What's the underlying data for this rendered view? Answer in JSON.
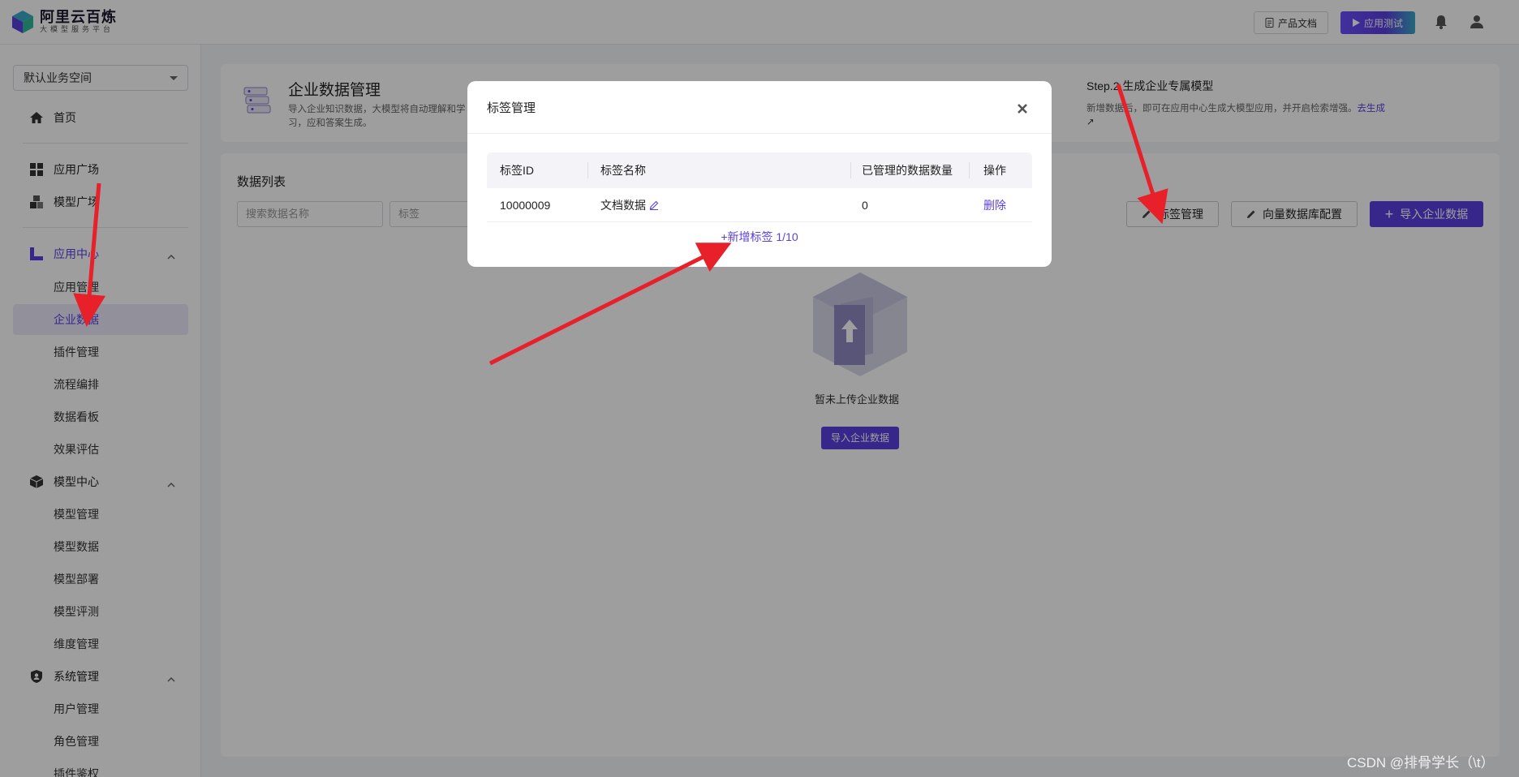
{
  "header": {
    "logo_title": "阿里云百炼",
    "logo_subtitle": "大模型服务平台",
    "doc_button": "产品文档",
    "test_button": "应用测试"
  },
  "sidebar": {
    "workspace": "默认业务空间",
    "items": {
      "home": "首页",
      "app_square": "应用广场",
      "model_square": "模型广场",
      "app_center": "应用中心",
      "app_manage": "应用管理",
      "enterprise_data": "企业数据",
      "plugin_manage": "插件管理",
      "flow": "流程编排",
      "data_board": "数据看板",
      "eval": "效果评估",
      "model_center": "模型中心",
      "model_manage": "模型管理",
      "model_data": "模型数据",
      "model_deploy": "模型部署",
      "model_eval": "模型评测",
      "dimension": "维度管理",
      "system": "系统管理",
      "user_manage": "用户管理",
      "role_manage": "角色管理",
      "plugin_auth": "插件鉴权"
    }
  },
  "main": {
    "intro_title": "企业数据管理",
    "intro_desc": "导入企业知识数据，大模型将自动理解和学习，应和答案生成。",
    "step2_title": "Step.2 生成企业专属模型",
    "step2_desc": "新增数据后，即可在应用中心生成大模型应用，并开启检索增强。",
    "step2_link": "去生成",
    "list_title": "数据列表",
    "search_placeholder": "搜索数据名称",
    "tag_placeholder": "标签",
    "btn_tag_manage": "标签管理",
    "btn_vector_config": "向量数据库配置",
    "btn_import": "导入企业数据",
    "empty_text": "暂未上传企业数据",
    "empty_import": "导入企业数据"
  },
  "modal": {
    "title": "标签管理",
    "columns": [
      "标签ID",
      "标签名称",
      "已管理的数据数量",
      "操作"
    ],
    "rows": [
      {
        "id": "10000009",
        "name": "文档数据",
        "count": "0",
        "action": "删除"
      }
    ],
    "add_tag": "+新增标签 1/10"
  },
  "watermark": "CSDN @排骨学长（\\t）",
  "colors": {
    "accent": "#5b3fe0",
    "arrow": "#e8202a"
  }
}
